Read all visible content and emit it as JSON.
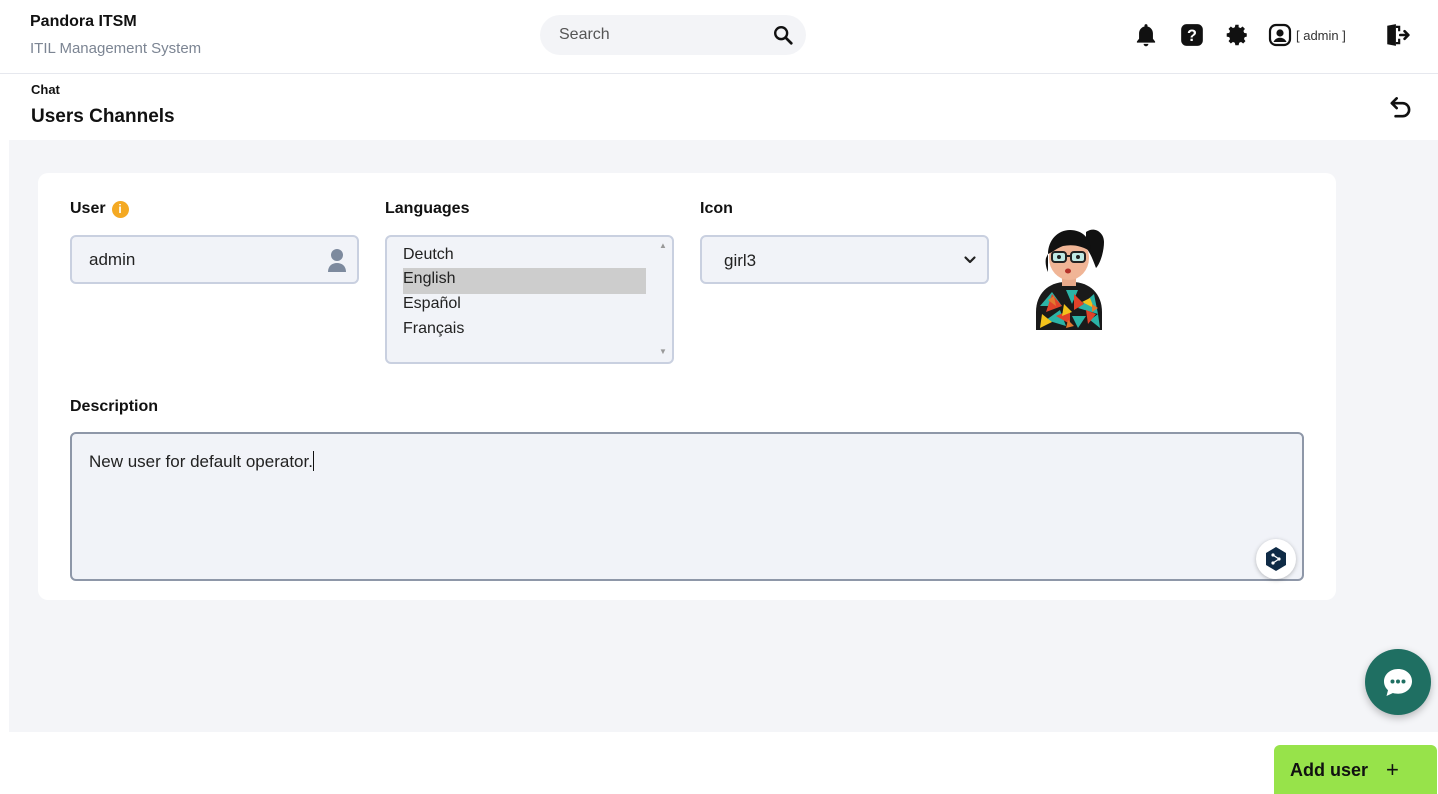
{
  "header": {
    "brand_title": "Pandora ITSM",
    "brand_subtitle": "ITIL Management System",
    "search_placeholder": "Search",
    "username": "[ admin ]",
    "icons": [
      "bell-icon",
      "help-icon",
      "gear-icon",
      "user-icon",
      "logout-icon"
    ]
  },
  "page": {
    "breadcrumb": "Chat",
    "title": "Users Channels"
  },
  "form": {
    "user_label": "User",
    "user_value": "admin",
    "languages_label": "Languages",
    "languages": [
      "Deutch",
      "English",
      "Español",
      "Français"
    ],
    "languages_selected": "English",
    "icon_label": "Icon",
    "icon_value": "girl3",
    "description_label": "Description",
    "description_value": "New user for default operator."
  },
  "actions": {
    "add_user_label": "Add user",
    "add_user_icon": "+"
  },
  "colors": {
    "accent_green": "#97e34a",
    "chat_fab": "#1f6f62",
    "info_orange": "#f4a923"
  }
}
